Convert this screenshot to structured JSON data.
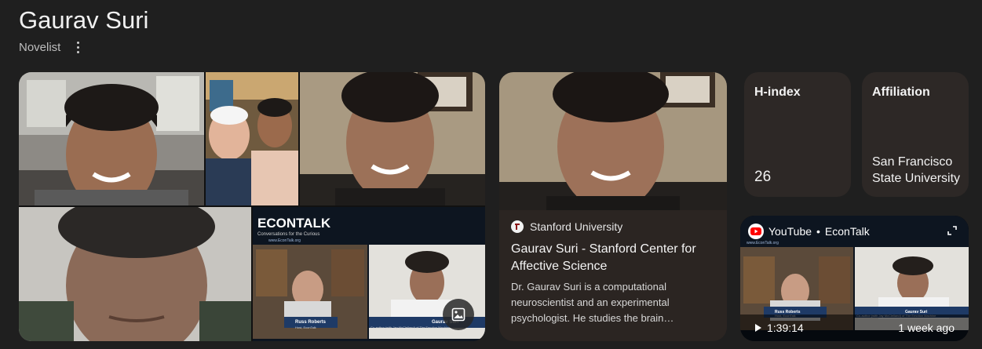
{
  "header": {
    "name": "Gaurav Suri",
    "role": "Novelist"
  },
  "collage": {
    "econtalk_logo": "ECONTALK",
    "econtalk_tagline": "Conversations for the Curious",
    "econtalk_url": "www.EconTalk.org",
    "lower_left_name": "Russ Roberts",
    "lower_left_caption": "Host, EconTalk",
    "lower_right_name": "Gaurav Suri",
    "lower_right_caption": "Co-author (with Jay McClelland) of The Emotion Machine",
    "icon": "image-icon"
  },
  "stanford_card": {
    "source": "Stanford University",
    "title": "Gaurav Suri - Stanford Center for Affective Science",
    "snippet": "Dr. Gaurav Suri is a computational neuroscientist and an experimental psychologist. He studies the brain…"
  },
  "hindex_card": {
    "label": "H-index",
    "value": "26"
  },
  "affiliation_card": {
    "label": "Affiliation",
    "line1": "San Francisco",
    "line2": "State University"
  },
  "youtube_card": {
    "platform": "YouTube",
    "separator": "•",
    "channel": "EconTalk",
    "duration": "1:39:14",
    "age": "1 week ago",
    "thumb_url": "www.EconTalk.org",
    "left_name": "Russ Roberts",
    "left_caption": "Host, EconTalk",
    "right_name": "Gaurav Suri",
    "right_caption": "Co-author (with Jay McClelland) of The Emotion Machine"
  },
  "colors": {
    "background": "#1f1f1f",
    "card": "#2d2826",
    "text": "#f2f2f2",
    "youtube_red": "#ff0000"
  }
}
